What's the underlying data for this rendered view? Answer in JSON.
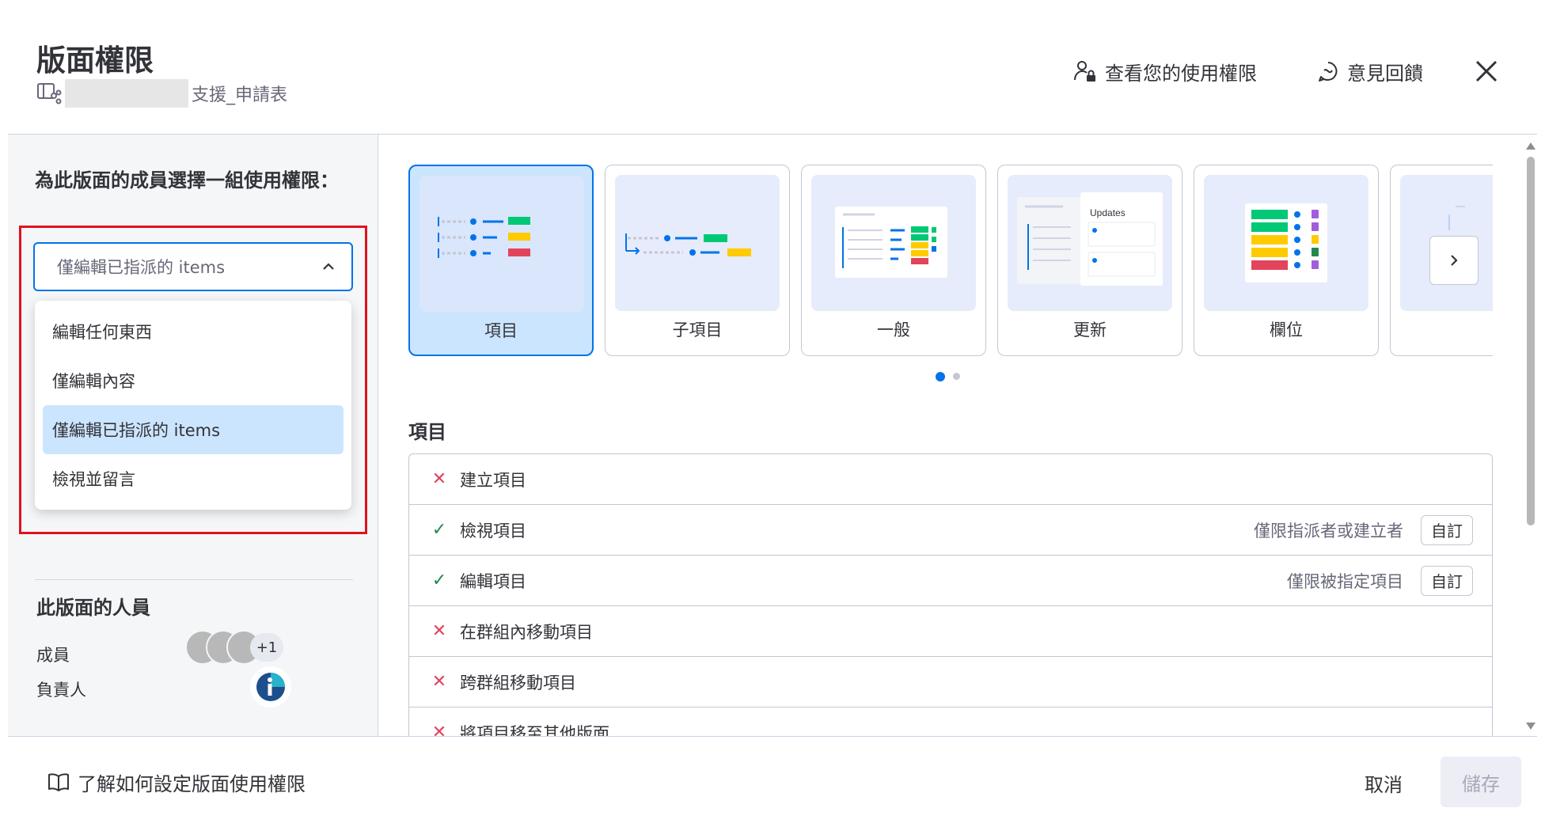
{
  "header": {
    "title": "版面權限",
    "board_name": "支援_申請表",
    "view_permissions_label": "查看您的使用權限",
    "feedback_label": "意見回饋"
  },
  "left": {
    "question": "為此版面的成員選擇一組使用權限：",
    "select_value": "僅編輯已指派的 items",
    "options": [
      {
        "label": "編輯任何東西",
        "selected": false
      },
      {
        "label": "僅編輯內容",
        "selected": false
      },
      {
        "label": "僅編輯已指派的 items",
        "selected": true
      },
      {
        "label": "檢視並留言",
        "selected": false
      }
    ],
    "people_title": "此版面的人員",
    "members_label": "成員",
    "members_more": "+1",
    "owner_label": "負責人"
  },
  "cards": [
    {
      "label": "項目",
      "active": true
    },
    {
      "label": "子項目",
      "active": false
    },
    {
      "label": "一般",
      "active": false
    },
    {
      "label": "更新",
      "active": false,
      "thumb_text": "Updates"
    },
    {
      "label": "欄位",
      "active": false
    }
  ],
  "carousel": {
    "pages": 2,
    "current": 1
  },
  "section_title": "項目",
  "permissions": [
    {
      "label": "建立項目",
      "allowed": false
    },
    {
      "label": "檢視項目",
      "allowed": true,
      "note": "僅限指派者或建立者",
      "button": "自訂"
    },
    {
      "label": "編輯項目",
      "allowed": true,
      "note": "僅限被指定項目",
      "button": "自訂"
    },
    {
      "label": "在群組內移動項目",
      "allowed": false
    },
    {
      "label": "跨群組移動項目",
      "allowed": false
    },
    {
      "label": "將項目移至其他版面",
      "allowed": false
    }
  ],
  "footer": {
    "learn_label": "了解如何設定版面使用權限",
    "cancel_label": "取消",
    "save_label": "儲存"
  },
  "colors": {
    "accent": "#0073ea",
    "selected_bg": "#cce5ff",
    "highlight_border": "#e0121f",
    "status_green": "#00c875",
    "status_yellow": "#ffcb00",
    "status_red": "#e2445c"
  }
}
